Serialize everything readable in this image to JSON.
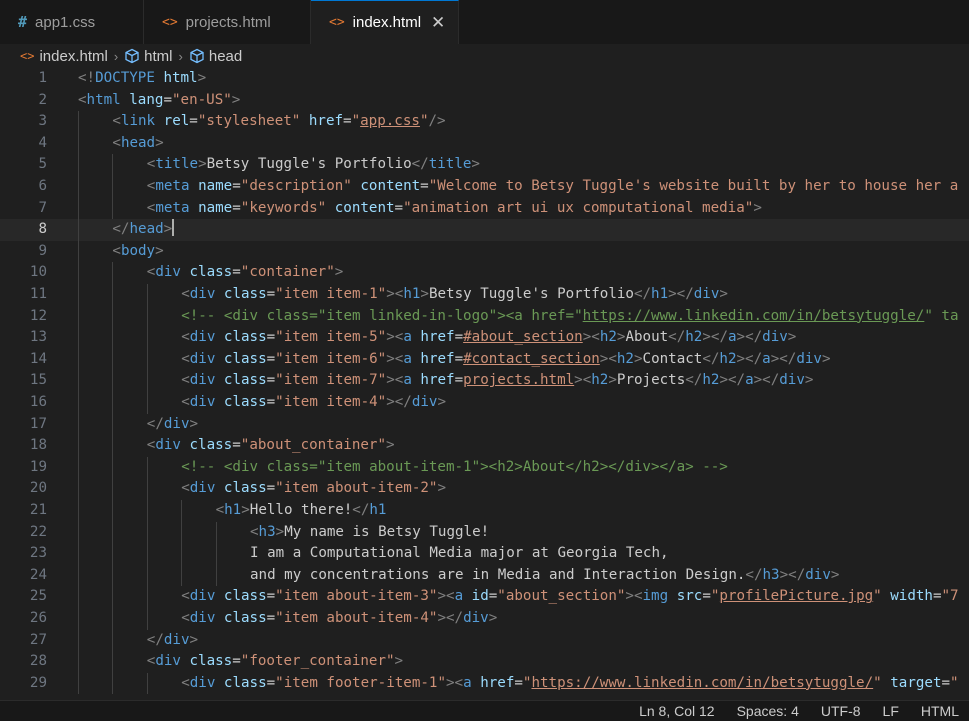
{
  "tabs": [
    {
      "icon": "#",
      "name": "app1.css",
      "type": "css"
    },
    {
      "icon": "<>",
      "name": "projects.html",
      "type": "html"
    },
    {
      "icon": "<>",
      "name": "index.html",
      "type": "html",
      "active": true
    }
  ],
  "breadcrumb": [
    "index.html",
    "html",
    "head"
  ],
  "lines": [
    {
      "n": "1",
      "i": 0,
      "t": [
        [
          "b",
          "<!"
        ],
        [
          "d",
          "DOCTYPE"
        ],
        [
          "x",
          " "
        ],
        [
          "a",
          "html"
        ],
        [
          "b",
          ">"
        ]
      ]
    },
    {
      "n": "2",
      "i": 0,
      "t": [
        [
          "b",
          "<"
        ],
        [
          "t",
          "html"
        ],
        [
          "x",
          " "
        ],
        [
          "a",
          "lang"
        ],
        [
          "x",
          "="
        ],
        [
          "s",
          "\"en-US\""
        ],
        [
          "b",
          ">"
        ]
      ]
    },
    {
      "n": "3",
      "i": 1,
      "t": [
        [
          "b",
          "<"
        ],
        [
          "t",
          "link"
        ],
        [
          "x",
          " "
        ],
        [
          "a",
          "rel"
        ],
        [
          "x",
          "="
        ],
        [
          "s",
          "\"stylesheet\""
        ],
        [
          "x",
          " "
        ],
        [
          "a",
          "href"
        ],
        [
          "x",
          "="
        ],
        [
          "s",
          "\""
        ],
        [
          "u",
          "app.css"
        ],
        [
          "s",
          "\""
        ],
        [
          "b",
          "/>"
        ]
      ]
    },
    {
      "n": "4",
      "i": 1,
      "t": [
        [
          "b",
          "<"
        ],
        [
          "t",
          "head"
        ],
        [
          "b",
          ">"
        ]
      ]
    },
    {
      "n": "5",
      "i": 2,
      "t": [
        [
          "b",
          "<"
        ],
        [
          "t",
          "title"
        ],
        [
          "b",
          ">"
        ],
        [
          "x",
          "Betsy Tuggle's Portfolio"
        ],
        [
          "b",
          "</"
        ],
        [
          "t",
          "title"
        ],
        [
          "b",
          ">"
        ]
      ]
    },
    {
      "n": "6",
      "i": 2,
      "t": [
        [
          "b",
          "<"
        ],
        [
          "t",
          "meta"
        ],
        [
          "x",
          " "
        ],
        [
          "a",
          "name"
        ],
        [
          "x",
          "="
        ],
        [
          "s",
          "\"description\""
        ],
        [
          "x",
          " "
        ],
        [
          "a",
          "content"
        ],
        [
          "x",
          "="
        ],
        [
          "s",
          "\"Welcome to Betsy Tuggle's website built by her to house her a"
        ]
      ]
    },
    {
      "n": "7",
      "i": 2,
      "t": [
        [
          "b",
          "<"
        ],
        [
          "t",
          "meta"
        ],
        [
          "x",
          " "
        ],
        [
          "a",
          "name"
        ],
        [
          "x",
          "="
        ],
        [
          "s",
          "\"keywords\""
        ],
        [
          "x",
          " "
        ],
        [
          "a",
          "content"
        ],
        [
          "x",
          "="
        ],
        [
          "s",
          "\"animation art ui ux computational media\""
        ],
        [
          "b",
          ">"
        ]
      ]
    },
    {
      "n": "8",
      "i": 1,
      "cur": true,
      "t": [
        [
          "b",
          "</"
        ],
        [
          "t",
          "head"
        ],
        [
          "b",
          ">"
        ]
      ]
    },
    {
      "n": "9",
      "i": 1,
      "t": [
        [
          "b",
          "<"
        ],
        [
          "t",
          "body"
        ],
        [
          "b",
          ">"
        ]
      ]
    },
    {
      "n": "10",
      "i": 2,
      "t": [
        [
          "b",
          "<"
        ],
        [
          "t",
          "div"
        ],
        [
          "x",
          " "
        ],
        [
          "a",
          "class"
        ],
        [
          "x",
          "="
        ],
        [
          "s",
          "\"container\""
        ],
        [
          "b",
          ">"
        ]
      ]
    },
    {
      "n": "11",
      "i": 3,
      "t": [
        [
          "b",
          "<"
        ],
        [
          "t",
          "div"
        ],
        [
          "x",
          " "
        ],
        [
          "a",
          "class"
        ],
        [
          "x",
          "="
        ],
        [
          "s",
          "\"item item-1\""
        ],
        [
          "b",
          "><"
        ],
        [
          "t",
          "h1"
        ],
        [
          "b",
          ">"
        ],
        [
          "x",
          "Betsy Tuggle's Portfolio"
        ],
        [
          "b",
          "</"
        ],
        [
          "t",
          "h1"
        ],
        [
          "b",
          "></"
        ],
        [
          "t",
          "div"
        ],
        [
          "b",
          ">"
        ]
      ]
    },
    {
      "n": "12",
      "i": 3,
      "t": [
        [
          "c",
          "<!-- <div class=\"item linked-in-logo\"><a href=\""
        ],
        [
          "cu",
          "https://www.linkedin.com/in/betsytuggle/"
        ],
        [
          "c",
          "\" ta"
        ]
      ]
    },
    {
      "n": "13",
      "i": 3,
      "t": [
        [
          "b",
          "<"
        ],
        [
          "t",
          "div"
        ],
        [
          "x",
          " "
        ],
        [
          "a",
          "class"
        ],
        [
          "x",
          "="
        ],
        [
          "s",
          "\"item item-5\""
        ],
        [
          "b",
          "><"
        ],
        [
          "t",
          "a"
        ],
        [
          "x",
          " "
        ],
        [
          "a",
          "href"
        ],
        [
          "x",
          "="
        ],
        [
          "u",
          "#about_section"
        ],
        [
          "b",
          "><"
        ],
        [
          "t",
          "h2"
        ],
        [
          "b",
          ">"
        ],
        [
          "x",
          "About"
        ],
        [
          "b",
          "</"
        ],
        [
          "t",
          "h2"
        ],
        [
          "b",
          "></"
        ],
        [
          "t",
          "a"
        ],
        [
          "b",
          "></"
        ],
        [
          "t",
          "div"
        ],
        [
          "b",
          ">"
        ]
      ]
    },
    {
      "n": "14",
      "i": 3,
      "t": [
        [
          "b",
          "<"
        ],
        [
          "t",
          "div"
        ],
        [
          "x",
          " "
        ],
        [
          "a",
          "class"
        ],
        [
          "x",
          "="
        ],
        [
          "s",
          "\"item item-6\""
        ],
        [
          "b",
          "><"
        ],
        [
          "t",
          "a"
        ],
        [
          "x",
          " "
        ],
        [
          "a",
          "href"
        ],
        [
          "x",
          "="
        ],
        [
          "u",
          "#contact_section"
        ],
        [
          "b",
          "><"
        ],
        [
          "t",
          "h2"
        ],
        [
          "b",
          ">"
        ],
        [
          "x",
          "Contact"
        ],
        [
          "b",
          "</"
        ],
        [
          "t",
          "h2"
        ],
        [
          "b",
          "></"
        ],
        [
          "t",
          "a"
        ],
        [
          "b",
          "></"
        ],
        [
          "t",
          "div"
        ],
        [
          "b",
          ">"
        ]
      ]
    },
    {
      "n": "15",
      "i": 3,
      "t": [
        [
          "b",
          "<"
        ],
        [
          "t",
          "div"
        ],
        [
          "x",
          " "
        ],
        [
          "a",
          "class"
        ],
        [
          "x",
          "="
        ],
        [
          "s",
          "\"item item-7\""
        ],
        [
          "b",
          "><"
        ],
        [
          "t",
          "a"
        ],
        [
          "x",
          " "
        ],
        [
          "a",
          "href"
        ],
        [
          "x",
          "="
        ],
        [
          "u",
          "projects.html"
        ],
        [
          "b",
          "><"
        ],
        [
          "t",
          "h2"
        ],
        [
          "b",
          ">"
        ],
        [
          "x",
          "Projects"
        ],
        [
          "b",
          "</"
        ],
        [
          "t",
          "h2"
        ],
        [
          "b",
          "></"
        ],
        [
          "t",
          "a"
        ],
        [
          "b",
          "></"
        ],
        [
          "t",
          "div"
        ],
        [
          "b",
          ">"
        ]
      ]
    },
    {
      "n": "16",
      "i": 3,
      "t": [
        [
          "b",
          "<"
        ],
        [
          "t",
          "div"
        ],
        [
          "x",
          " "
        ],
        [
          "a",
          "class"
        ],
        [
          "x",
          "="
        ],
        [
          "s",
          "\"item item-4\""
        ],
        [
          "b",
          "></"
        ],
        [
          "t",
          "div"
        ],
        [
          "b",
          ">"
        ]
      ]
    },
    {
      "n": "17",
      "i": 2,
      "t": [
        [
          "b",
          "</"
        ],
        [
          "t",
          "div"
        ],
        [
          "b",
          ">"
        ]
      ]
    },
    {
      "n": "18",
      "i": 2,
      "t": [
        [
          "b",
          "<"
        ],
        [
          "t",
          "div"
        ],
        [
          "x",
          " "
        ],
        [
          "a",
          "class"
        ],
        [
          "x",
          "="
        ],
        [
          "s",
          "\"about_container\""
        ],
        [
          "b",
          ">"
        ]
      ]
    },
    {
      "n": "19",
      "i": 3,
      "t": [
        [
          "c",
          "<!-- <div class=\"item about-item-1\"><h2>About</h2></div></a> -->"
        ]
      ]
    },
    {
      "n": "20",
      "i": 3,
      "t": [
        [
          "b",
          "<"
        ],
        [
          "t",
          "div"
        ],
        [
          "x",
          " "
        ],
        [
          "a",
          "class"
        ],
        [
          "x",
          "="
        ],
        [
          "s",
          "\"item about-item-2\""
        ],
        [
          "b",
          ">"
        ]
      ]
    },
    {
      "n": "21",
      "i": 4,
      "t": [
        [
          "b",
          "<"
        ],
        [
          "t",
          "h1"
        ],
        [
          "b",
          ">"
        ],
        [
          "x",
          "Hello there!"
        ],
        [
          "b",
          "</"
        ],
        [
          "t",
          "h1"
        ]
      ]
    },
    {
      "n": "22",
      "i": 5,
      "t": [
        [
          "b",
          "<"
        ],
        [
          "t",
          "h3"
        ],
        [
          "b",
          ">"
        ],
        [
          "x",
          "My name is Betsy Tuggle!"
        ]
      ]
    },
    {
      "n": "23",
      "i": 5,
      "t": [
        [
          "x",
          "I am a Computational Media major at Georgia Tech,"
        ]
      ]
    },
    {
      "n": "24",
      "i": 5,
      "t": [
        [
          "x",
          "and my concentrations are in Media and Interaction Design."
        ],
        [
          "b",
          "</"
        ],
        [
          "t",
          "h3"
        ],
        [
          "b",
          "></"
        ],
        [
          "t",
          "div"
        ],
        [
          "b",
          ">"
        ]
      ]
    },
    {
      "n": "25",
      "i": 3,
      "t": [
        [
          "b",
          "<"
        ],
        [
          "t",
          "div"
        ],
        [
          "x",
          " "
        ],
        [
          "a",
          "class"
        ],
        [
          "x",
          "="
        ],
        [
          "s",
          "\"item about-item-3\""
        ],
        [
          "b",
          "><"
        ],
        [
          "t",
          "a"
        ],
        [
          "x",
          " "
        ],
        [
          "a",
          "id"
        ],
        [
          "x",
          "="
        ],
        [
          "s",
          "\"about_section\""
        ],
        [
          "b",
          "><"
        ],
        [
          "t",
          "img"
        ],
        [
          "x",
          " "
        ],
        [
          "a",
          "src"
        ],
        [
          "x",
          "="
        ],
        [
          "s",
          "\""
        ],
        [
          "u",
          "profilePicture.jpg"
        ],
        [
          "s",
          "\""
        ],
        [
          "x",
          " "
        ],
        [
          "a",
          "width"
        ],
        [
          "x",
          "="
        ],
        [
          "s",
          "\"7"
        ]
      ]
    },
    {
      "n": "26",
      "i": 3,
      "t": [
        [
          "b",
          "<"
        ],
        [
          "t",
          "div"
        ],
        [
          "x",
          " "
        ],
        [
          "a",
          "class"
        ],
        [
          "x",
          "="
        ],
        [
          "s",
          "\"item about-item-4\""
        ],
        [
          "b",
          "></"
        ],
        [
          "t",
          "div"
        ],
        [
          "b",
          ">"
        ]
      ]
    },
    {
      "n": "27",
      "i": 2,
      "t": [
        [
          "b",
          "</"
        ],
        [
          "t",
          "div"
        ],
        [
          "b",
          ">"
        ]
      ]
    },
    {
      "n": "28",
      "i": 2,
      "t": [
        [
          "b",
          "<"
        ],
        [
          "t",
          "div"
        ],
        [
          "x",
          " "
        ],
        [
          "a",
          "class"
        ],
        [
          "x",
          "="
        ],
        [
          "s",
          "\"footer_container\""
        ],
        [
          "b",
          ">"
        ]
      ]
    },
    {
      "n": "29",
      "i": 3,
      "t": [
        [
          "b",
          "<"
        ],
        [
          "t",
          "div"
        ],
        [
          "x",
          " "
        ],
        [
          "a",
          "class"
        ],
        [
          "x",
          "="
        ],
        [
          "s",
          "\"item footer-item-1\""
        ],
        [
          "b",
          "><"
        ],
        [
          "t",
          "a"
        ],
        [
          "x",
          " "
        ],
        [
          "a",
          "href"
        ],
        [
          "x",
          "="
        ],
        [
          "s",
          "\""
        ],
        [
          "u",
          "https://www.linkedin.com/in/betsytuggle/"
        ],
        [
          "s",
          "\""
        ],
        [
          "x",
          " "
        ],
        [
          "a",
          "target"
        ],
        [
          "x",
          "="
        ],
        [
          "s",
          "\""
        ]
      ]
    }
  ],
  "status": {
    "position": "Ln 8, Col 12",
    "spaces": "Spaces: 4",
    "encoding": "UTF-8",
    "eol": "LF",
    "language": "HTML"
  },
  "colors": {
    "background": "#1f1f1f",
    "tag": "#569cd6",
    "attribute": "#9cdcfe",
    "string": "#ce9178",
    "comment": "#6a9955",
    "bracket": "#808080",
    "accent": "#0078d4"
  }
}
